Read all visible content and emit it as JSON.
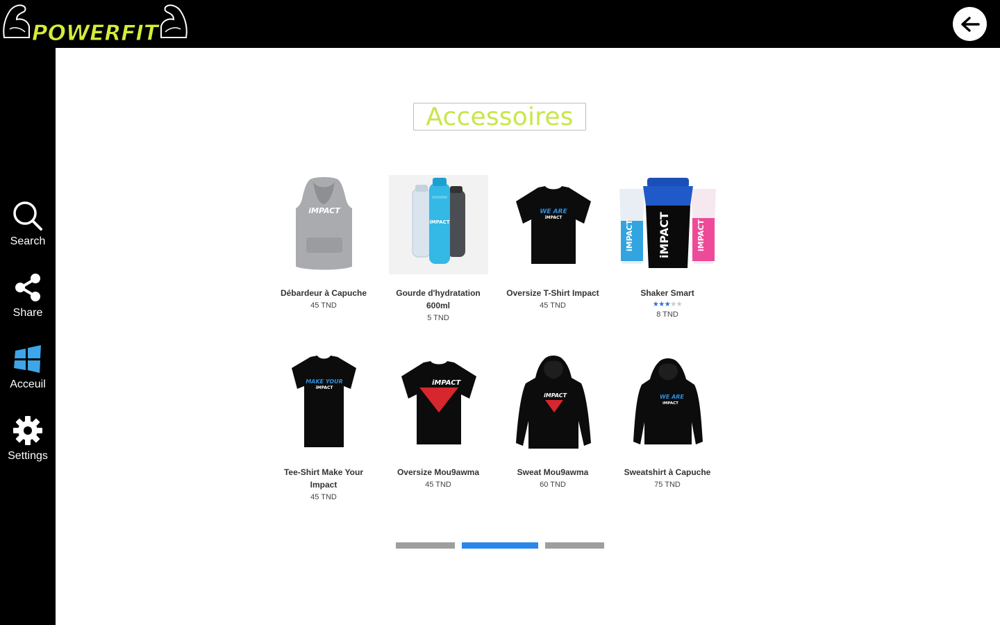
{
  "header": {
    "logo_text": "POWERFIT",
    "back_button_icon": "arrow-left-icon"
  },
  "sidebar": {
    "items": [
      {
        "label": "Search",
        "icon": "search-icon"
      },
      {
        "label": "Share",
        "icon": "share-icon"
      },
      {
        "label": "Acceuil",
        "icon": "windows-icon"
      },
      {
        "label": "Settings",
        "icon": "gear-icon"
      }
    ]
  },
  "page": {
    "title": "Accessoires",
    "title_color": "#c8e64a"
  },
  "products": [
    {
      "name": "Débardeur à Capuche",
      "price": "45 TND"
    },
    {
      "name": "Gourde d'hydratation 600ml",
      "price": "5 TND"
    },
    {
      "name": "Oversize T-Shirt Impact",
      "price": "45 TND"
    },
    {
      "name": "Shaker Smart",
      "price": "8 TND",
      "rating": 3,
      "rating_max": 5
    },
    {
      "name": "Tee-Shirt Make Your Impact",
      "price": "45 TND"
    },
    {
      "name": "Oversize Mou9awma",
      "price": "45 TND"
    },
    {
      "name": "Sweat Mou9awma",
      "price": "60 TND"
    },
    {
      "name": "Sweatshirt à Capuche",
      "price": "75 TND"
    }
  ],
  "pagination": {
    "pages": 3,
    "active_page": 2,
    "active_color": "#2a86e8",
    "inactive_color": "#9e9e9e"
  }
}
